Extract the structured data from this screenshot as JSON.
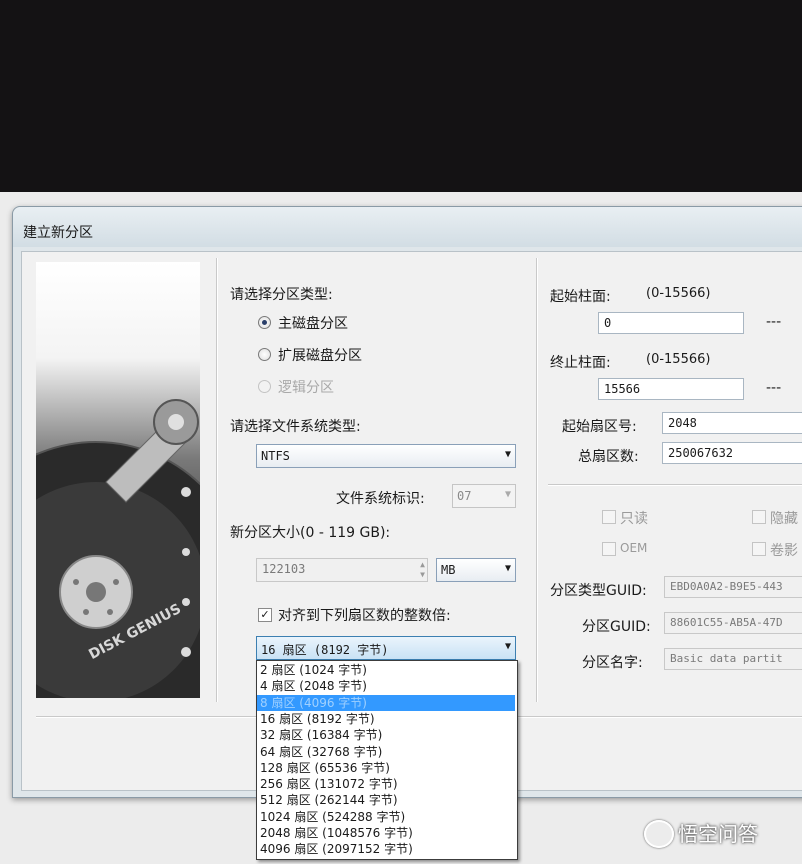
{
  "window": {
    "title": "建立新分区"
  },
  "logo": {
    "brand": "DISK GENIUS"
  },
  "partition_type": {
    "heading": "请选择分区类型:",
    "options": [
      {
        "label": "主磁盘分区",
        "selected": true,
        "disabled": false
      },
      {
        "label": "扩展磁盘分区",
        "selected": false,
        "disabled": false
      },
      {
        "label": "逻辑分区",
        "selected": false,
        "disabled": true
      }
    ]
  },
  "filesystem": {
    "heading": "请选择文件系统类型:",
    "value": "NTFS",
    "id_label": "文件系统标识:",
    "id_value": "07"
  },
  "size": {
    "label": "新分区大小(0 - 119 GB):",
    "value": "122103",
    "unit": "MB"
  },
  "align": {
    "checkbox_label": "对齐到下列扇区数的整数倍:",
    "checked": true,
    "selected": "16 扇区 (8192 字节)",
    "options": [
      "2 扇区 (1024 字节)",
      "4 扇区 (2048 字节)",
      "8 扇区 (4096 字节)",
      "16 扇区 (8192 字节)",
      "32 扇区 (16384 字节)",
      "64 扇区 (32768 字节)",
      "128 扇区 (65536 字节)",
      "256 扇区 (131072 字节)",
      "512 扇区 (262144 字节)",
      "1024 扇区 (524288 字节)",
      "2048 扇区 (1048576 字节)",
      "4096 扇区 (2097152 字节)"
    ],
    "highlighted_index": 2
  },
  "geometry": {
    "start_cyl_label": "起始柱面:",
    "start_cyl_range": "(0-15566)",
    "start_cyl_value": "0",
    "end_cyl_label": "终止柱面:",
    "end_cyl_range": "(0-15566)",
    "end_cyl_value": "15566",
    "dash": "---",
    "start_sector_label": "起始扇区号:",
    "start_sector_value": "2048",
    "total_sectors_label": "总扇区数:",
    "total_sectors_value": "250067632"
  },
  "attributes": {
    "readonly": "只读",
    "hidden": "隐藏",
    "oem": "OEM",
    "shadow": "卷影"
  },
  "guid": {
    "type_label": "分区类型GUID:",
    "type_value": "EBD0A0A2-B9E5-443",
    "part_label": "分区GUID:",
    "part_value": "88601C55-AB5A-47D",
    "name_label": "分区名字:",
    "name_value": "Basic data partit"
  },
  "watermark": {
    "text": "悟空问答"
  }
}
